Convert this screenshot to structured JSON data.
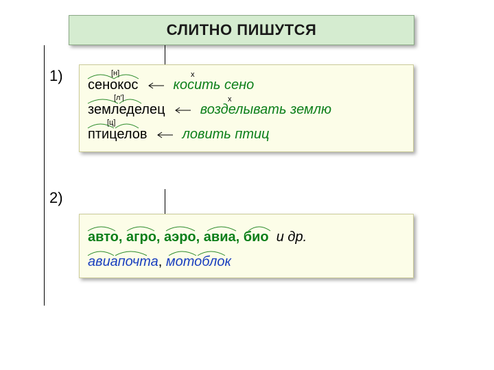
{
  "header": {
    "title": "СЛИТНО ПИШУТСЯ"
  },
  "numbers": {
    "one": "1)",
    "two": "2)"
  },
  "box1": {
    "r1": {
      "word": "сенокос",
      "def": "косить сено",
      "phon": "[н]",
      "x": "х"
    },
    "r2": {
      "word": "земледелец",
      "def": "возделывать землю",
      "phon": "[л']",
      "x": "х"
    },
    "r3": {
      "word": "птицелов",
      "def": "ловить птиц",
      "phon": "[ц]"
    }
  },
  "box2": {
    "prefixes": {
      "p1": "авто",
      "p2": "агро",
      "p3": "аэро",
      "p4": "авиа",
      "p5": "био",
      "etc": "и др."
    },
    "examples": {
      "e1": "авиапочта",
      "e2": "мотоблок",
      "comma": ","
    }
  },
  "punct": {
    "comma": ","
  }
}
